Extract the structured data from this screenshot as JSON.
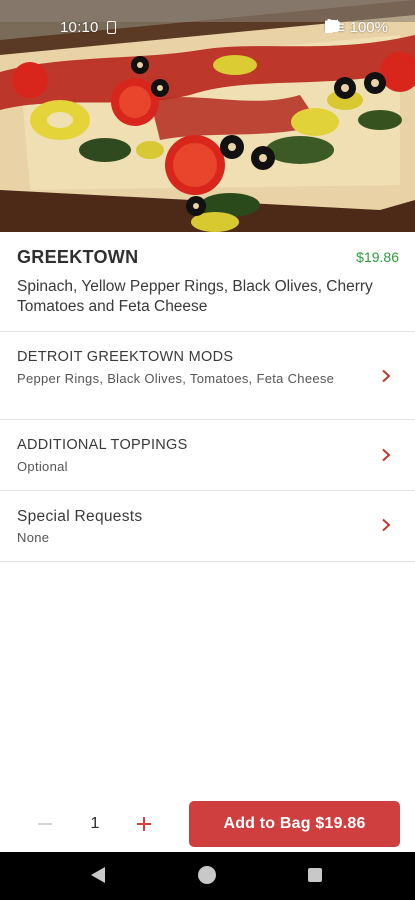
{
  "status_bar": {
    "time": "10:10",
    "network": "LTE",
    "battery": "100%"
  },
  "item": {
    "name": "GREEKTOWN",
    "price": "$19.86",
    "description": "Spinach, Yellow Pepper Rings, Black Olives, Cherry Tomatoes and Feta Cheese",
    "image_icon": "pizza-photo"
  },
  "options": [
    {
      "title": "DETROIT GREEKTOWN MODS",
      "subtitle": "Pepper Rings, Black Olives, Tomatoes, Feta Cheese"
    },
    {
      "title": "ADDITIONAL TOPPINGS",
      "subtitle": "Optional"
    },
    {
      "title": "Special Requests",
      "subtitle": "None"
    }
  ],
  "quantity": {
    "value": "1"
  },
  "add_button": {
    "label": "Add to Bag $19.86"
  },
  "colors": {
    "accent": "#cf3f3f",
    "price": "#2e9e3a",
    "chevron": "#c0392b"
  }
}
